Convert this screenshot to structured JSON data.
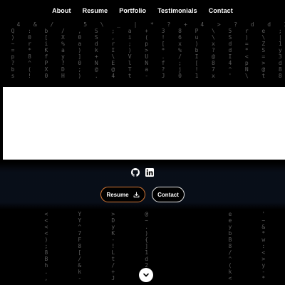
{
  "nav": {
    "items": [
      "About",
      "Resume",
      "Portfolio",
      "Testimonials",
      "Contact"
    ]
  },
  "background": {
    "rows_top": [
      "   4  &  /     5  \\  _  |  *  ?  +  4  >  ?  d  d  3  u  6",
      "  Q  :  b  /  ,  S  ;  a  +  3  8  P  \\  5  r  e  ;  .  <",
      "  )  0  [  X  0  S  ,  i  (  !  6  u  \\  S  )  \\  |  4  u",
      "  ~  r  i  %  a  d  r  ;  p  [  x  )  x  d  =  Z  1  *  N  8",
      "  =  *  K  a  )  k  I  )  >  *  %  b  ?  d  *  S  y  S  ~  ?",
      "  p  8  f  y  ]  +  \\  V  U  .  /  I  @  I  <  =  3  ^  T  G",
      "  ?  ^  P  ?  0  N  E  l  N  f  ;  [  8  4  p  >  d  [  o  x",
      "  b  (  X  D  ;  @  @  T  a  ?  j  !  7  ^  N  @  8  m  T  E",
      "  s  !  0  H  )  .  4  t  -  J  0  1  x  '  \\  t  8  3  W  /"
    ],
    "rows_bottom": [
      "        <     Y     >     @              e     '     ~",
      "        <     Y     D     ~              e     ~     )",
      "        <     ^     y     .              y     &     ,",
      "        <     7     K     )              b     *     ~",
      "        )     F     -     {              B     w     -",
      "        ;     8     !     ]              8     :     ~",
      "        8     [     L     1              /     <     _",
      "        B     /     t     d              ^     >     .",
      "        h     &     /     2              (     y     ?",
      "        .     k     +     S              k     -     '",
      "        ,     -     J     $              <     *     ("
    ]
  },
  "socials": [
    {
      "name": "github-icon"
    },
    {
      "name": "linkedin-icon"
    }
  ],
  "cta": {
    "resume_label": "Resume",
    "contact_label": "Contact"
  }
}
